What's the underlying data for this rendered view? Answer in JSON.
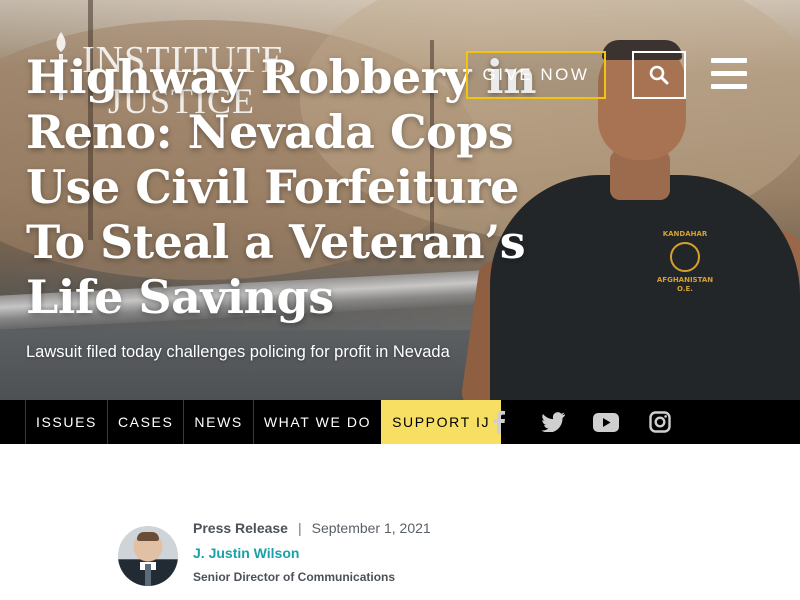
{
  "brand": {
    "line1": "INSTITUTE",
    "line2": "JUSTICE"
  },
  "header": {
    "give_label": "GIVE NOW",
    "search_icon": "search-icon",
    "menu_icon": "hamburger-menu-icon",
    "accent_color": "#f1c40f"
  },
  "hero": {
    "headline": "Highway Robbery in Reno: Nevada Cops Use Civil Forfeiture To Steal a Veteran’s Life Savings",
    "subheadline": "Lawsuit filed today challenges policing for profit in Nevada",
    "shirt_print": {
      "top": "KANDAHAR",
      "bottom": "AFGHANISTAN O.E."
    }
  },
  "nav": {
    "items": [
      {
        "label": "ISSUES"
      },
      {
        "label": "CASES"
      },
      {
        "label": "NEWS"
      },
      {
        "label": "WHAT WE DO"
      },
      {
        "label": "SUPPORT IJ"
      }
    ],
    "social": [
      "facebook-icon",
      "twitter-icon",
      "youtube-icon",
      "instagram-icon"
    ],
    "support_color": "#f7df63"
  },
  "article": {
    "type": "Press Release",
    "separator": "|",
    "date": "September 1, 2021",
    "author": "J. Justin Wilson",
    "author_title": "Senior Director of Communications",
    "author_color": "#1aa0a8"
  }
}
